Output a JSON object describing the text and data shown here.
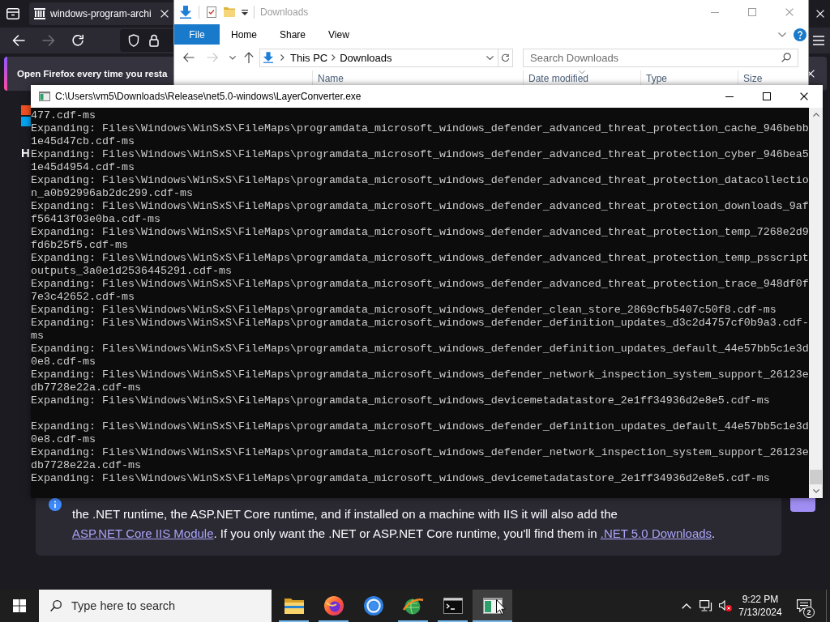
{
  "browser": {
    "tab": {
      "title": "windows-program-archi"
    },
    "notification": {
      "message": "Open Firefox every time you resta"
    },
    "page": {
      "heading": "H",
      "note": [
        {
          "kind": "text",
          "text": "the .NET runtime, the ASP.NET Core runtime, and if installed on a machine with IIS it will also add the "
        },
        {
          "kind": "link",
          "text": "ASP.NET Core IIS Module"
        },
        {
          "kind": "text",
          "text": ". If you only want the .NET or ASP.NET Core runtime, you'll find them in "
        },
        {
          "kind": "link",
          "text": ".NET 5.0 Downloads"
        },
        {
          "kind": "text",
          "text": "."
        }
      ]
    }
  },
  "explorer": {
    "title": "Downloads",
    "file_button": "File",
    "ribbon_tabs": [
      "Home",
      "Share",
      "View"
    ],
    "breadcrumbs": [
      "This PC",
      "Downloads"
    ],
    "search": {
      "placeholder": "Search Downloads"
    },
    "columns": [
      {
        "label": "Name",
        "sorted": false
      },
      {
        "label": "Date modified",
        "sorted": true
      },
      {
        "label": "Type",
        "sorted": false
      },
      {
        "label": "Size",
        "sorted": false
      }
    ]
  },
  "console": {
    "title": "C:\\Users\\vm5\\Downloads\\Release\\net5.0-windows\\LayerConverter.exe",
    "output_blocks": [
      {
        "lines": [
          "477.cdf-ms",
          "Expanding: Files\\Windows\\WinSxS\\FileMaps\\programdata_microsoft_windows_defender_advanced_threat_protection_cache_946bebb",
          "1e45d47cb.cdf-ms",
          "Expanding: Files\\Windows\\WinSxS\\FileMaps\\programdata_microsoft_windows_defender_advanced_threat_protection_cyber_946bea5",
          "1e45d4954.cdf-ms",
          "Expanding: Files\\Windows\\WinSxS\\FileMaps\\programdata_microsoft_windows_defender_advanced_threat_protection_datacollectio",
          "n_a0b92996ab2dc299.cdf-ms",
          "Expanding: Files\\Windows\\WinSxS\\FileMaps\\programdata_microsoft_windows_defender_advanced_threat_protection_downloads_9af",
          "f56413f03e0ba.cdf-ms",
          "Expanding: Files\\Windows\\WinSxS\\FileMaps\\programdata_microsoft_windows_defender_advanced_threat_protection_temp_7268e2d9",
          "fd6b25f5.cdf-ms",
          "Expanding: Files\\Windows\\WinSxS\\FileMaps\\programdata_microsoft_windows_defender_advanced_threat_protection_temp_psscript",
          "outputs_3a0e1d2536445291.cdf-ms",
          "Expanding: Files\\Windows\\WinSxS\\FileMaps\\programdata_microsoft_windows_defender_advanced_threat_protection_trace_948df0f",
          "7e3c42652.cdf-ms",
          "Expanding: Files\\Windows\\WinSxS\\FileMaps\\programdata_microsoft_windows_defender_clean_store_2869cfb5407c50f8.cdf-ms",
          "Expanding: Files\\Windows\\WinSxS\\FileMaps\\programdata_microsoft_windows_defender_definition_updates_d3c2d4757cf0b9a3.cdf-",
          "ms",
          "Expanding: Files\\Windows\\WinSxS\\FileMaps\\programdata_microsoft_windows_defender_definition_updates_default_44e57bb5c1e3d",
          "0e8.cdf-ms",
          "Expanding: Files\\Windows\\WinSxS\\FileMaps\\programdata_microsoft_windows_defender_network_inspection_system_support_26123e",
          "db7728e22a.cdf-ms",
          "Expanding: Files\\Windows\\WinSxS\\FileMaps\\programdata_microsoft_windows_devicemetadatastore_2e1ff34936d2e8e5.cdf-ms"
        ]
      },
      {
        "lines": [
          "Expanding: Files\\Windows\\WinSxS\\FileMaps\\programdata_microsoft_windows_defender_definition_updates_default_44e57bb5c1e3d",
          "0e8.cdf-ms",
          "Expanding: Files\\Windows\\WinSxS\\FileMaps\\programdata_microsoft_windows_defender_network_inspection_system_support_26123e",
          "db7728e22a.cdf-ms",
          "Expanding: Files\\Windows\\WinSxS\\FileMaps\\programdata_microsoft_windows_devicemetadatastore_2e1ff34936d2e8e5.cdf-ms"
        ]
      }
    ]
  },
  "taskbar": {
    "search": {
      "placeholder": "Type here to search"
    },
    "apps": [
      {
        "kind": "file-explorer",
        "running": true,
        "selected": false
      },
      {
        "kind": "firefox",
        "running": true,
        "selected": false
      },
      {
        "kind": "ring",
        "running": false,
        "selected": false
      },
      {
        "kind": "globe",
        "running": true,
        "selected": false
      },
      {
        "kind": "terminal",
        "running": true,
        "selected": false
      },
      {
        "kind": "app-window",
        "running": true,
        "selected": true
      }
    ],
    "clock": {
      "time": "9:22 PM",
      "date": "7/13/2024"
    },
    "notification_count": "2"
  }
}
